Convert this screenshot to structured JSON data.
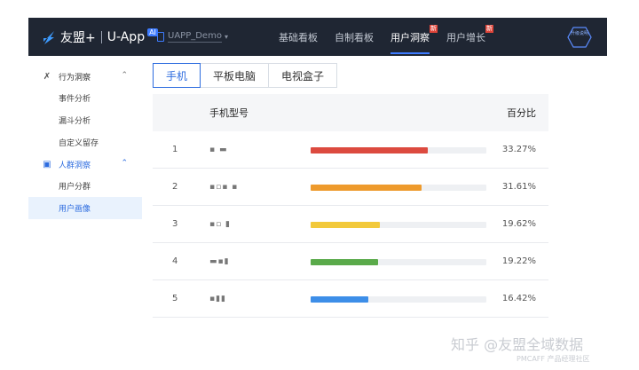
{
  "header": {
    "brand": "友盟+",
    "product": "U-App",
    "product_badge": "AI",
    "app_name": "UAPP_Demo",
    "nav": [
      {
        "label": "基础看板",
        "active": false,
        "badge": ""
      },
      {
        "label": "自制看板",
        "active": false,
        "badge": ""
      },
      {
        "label": "用户洞察",
        "active": true,
        "badge": "新"
      },
      {
        "label": "用户增长",
        "active": false,
        "badge": "新"
      }
    ],
    "upgrade_label": "升级说明"
  },
  "sidebar": {
    "groups": [
      {
        "label": "行为洞察",
        "icon": "behavior-icon",
        "items": [
          {
            "label": "事件分析",
            "active": false
          },
          {
            "label": "漏斗分析",
            "active": false
          },
          {
            "label": "自定义留存",
            "active": false
          }
        ]
      },
      {
        "label": "人群洞察",
        "icon": "crowd-icon",
        "items": [
          {
            "label": "用户分群",
            "active": false
          },
          {
            "label": "用户画像",
            "active": true
          }
        ]
      }
    ]
  },
  "tabs": [
    {
      "label": "手机",
      "active": true
    },
    {
      "label": "平板电脑",
      "active": false
    },
    {
      "label": "电视盒子",
      "active": false
    }
  ],
  "table": {
    "col_model": "手机型号",
    "col_percent": "百分比",
    "rows": [
      {
        "rank": "1",
        "model": "▪ ▬",
        "percent": "33.27%",
        "share": 0.3327,
        "color": "#dc4a3f"
      },
      {
        "rank": "2",
        "model": "▪▫▪ ▪",
        "percent": "31.61%",
        "share": 0.3161,
        "color": "#ee9a2c"
      },
      {
        "rank": "3",
        "model": "▪▫ ▮",
        "percent": "19.62%",
        "share": 0.1962,
        "color": "#f2c93b"
      },
      {
        "rank": "4",
        "model": "▬▪▮",
        "percent": "19.22%",
        "share": 0.1922,
        "color": "#5aaa4a"
      },
      {
        "rank": "5",
        "model": "▪▮▮",
        "percent": "16.42%",
        "share": 0.1642,
        "color": "#3d8ee8"
      }
    ]
  },
  "watermark": {
    "main": "知乎 @友盟全域数据",
    "sub": "PMCAFF 产品经理社区"
  }
}
